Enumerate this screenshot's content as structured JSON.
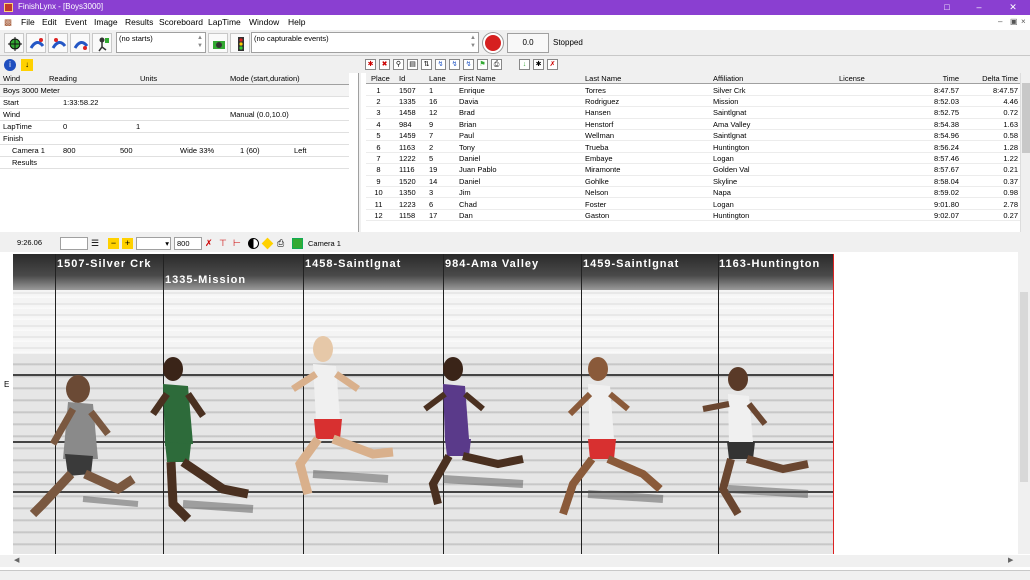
{
  "window": {
    "title": "FinishLynx - [Boys3000]"
  },
  "menu": [
    "File",
    "Edit",
    "Event",
    "Image",
    "Results",
    "Scoreboard",
    "LapTime",
    "Window",
    "Help"
  ],
  "toolbar": {
    "starts": "(no starts)",
    "events": "(no capturable events)",
    "time": "0.0",
    "status": "Stopped"
  },
  "left_grid": {
    "headers": [
      "Wind",
      "Reading",
      "Units",
      "Mode (start,duration)"
    ],
    "event_name": "Boys 3000 Meter",
    "rows": [
      {
        "label": "Start",
        "c1": "1:33:58.22",
        "c2": "",
        "c3": "",
        "c4": ""
      },
      {
        "label": "Wind",
        "c1": "",
        "c2": "",
        "c3": "Manual (0.0,10.0)",
        "c4": ""
      },
      {
        "label": "LapTime",
        "c1": "0",
        "c2": "1",
        "c3": "",
        "c4": ""
      },
      {
        "label": "Finish",
        "c1": "",
        "c2": "",
        "c3": "",
        "c4": ""
      },
      {
        "label": "Camera 1",
        "c1": "800",
        "c2": "500",
        "c3": "Wide 33%",
        "c4": "1 (60)",
        "c5": "Left"
      },
      {
        "label": "Results",
        "c1": "",
        "c2": "",
        "c3": "",
        "c4": ""
      }
    ]
  },
  "results": {
    "headers": [
      "Place",
      "Id",
      "Lane",
      "First Name",
      "Last Name",
      "Affiliation",
      "License",
      "Time",
      "Delta Time"
    ],
    "rows": [
      [
        "1",
        "1507",
        "1",
        "Enrique",
        "Torres",
        "Silver Crk",
        "",
        "8:47.57",
        "8:47.57"
      ],
      [
        "2",
        "1335",
        "16",
        "Davia",
        "Rodriguez",
        "Mission",
        "",
        "8:52.03",
        "4.46"
      ],
      [
        "3",
        "1458",
        "12",
        "Brad",
        "Hansen",
        "Saintlgnat",
        "",
        "8:52.75",
        "0.72"
      ],
      [
        "4",
        "984",
        "9",
        "Brian",
        "Henstorf",
        "Ama Valley",
        "",
        "8:54.38",
        "1.63"
      ],
      [
        "5",
        "1459",
        "7",
        "Paul",
        "Wellman",
        "Saintlgnat",
        "",
        "8:54.96",
        "0.58"
      ],
      [
        "6",
        "1163",
        "2",
        "Tony",
        "Trueba",
        "Huntington",
        "",
        "8:56.24",
        "1.28"
      ],
      [
        "7",
        "1222",
        "5",
        "Daniel",
        "Embaye",
        "Logan",
        "",
        "8:57.46",
        "1.22"
      ],
      [
        "8",
        "1116",
        "19",
        "Juan Pablo",
        "Miramonte",
        "Golden Val",
        "",
        "8:57.67",
        "0.21"
      ],
      [
        "9",
        "1520",
        "14",
        "Daniel",
        "Gohlke",
        "Skyline",
        "",
        "8:58.04",
        "0.37"
      ],
      [
        "10",
        "1350",
        "3",
        "Jim",
        "Nelson",
        "Napa",
        "",
        "8:59.02",
        "0.98"
      ],
      [
        "11",
        "1223",
        "6",
        "Chad",
        "Foster",
        "Logan",
        "",
        "9:01.80",
        "2.78"
      ],
      [
        "12",
        "1158",
        "17",
        "Dan",
        "Gaston",
        "Huntington",
        "",
        "9:02.07",
        "0.27"
      ]
    ]
  },
  "image_bar": {
    "time": "9:26.06",
    "zoom": "800",
    "camera": "Camera 1"
  },
  "photo": {
    "side_letter": "E",
    "labels": [
      "1507-Silver Crk",
      "1335-Mission",
      "1458-Saintlgnat",
      "984-Ama Valley",
      "1459-Saintlgnat",
      "1163-Huntington"
    ]
  },
  "colors": {
    "titlebar": "#8a3fd1",
    "finish_line": "#dd2222"
  }
}
